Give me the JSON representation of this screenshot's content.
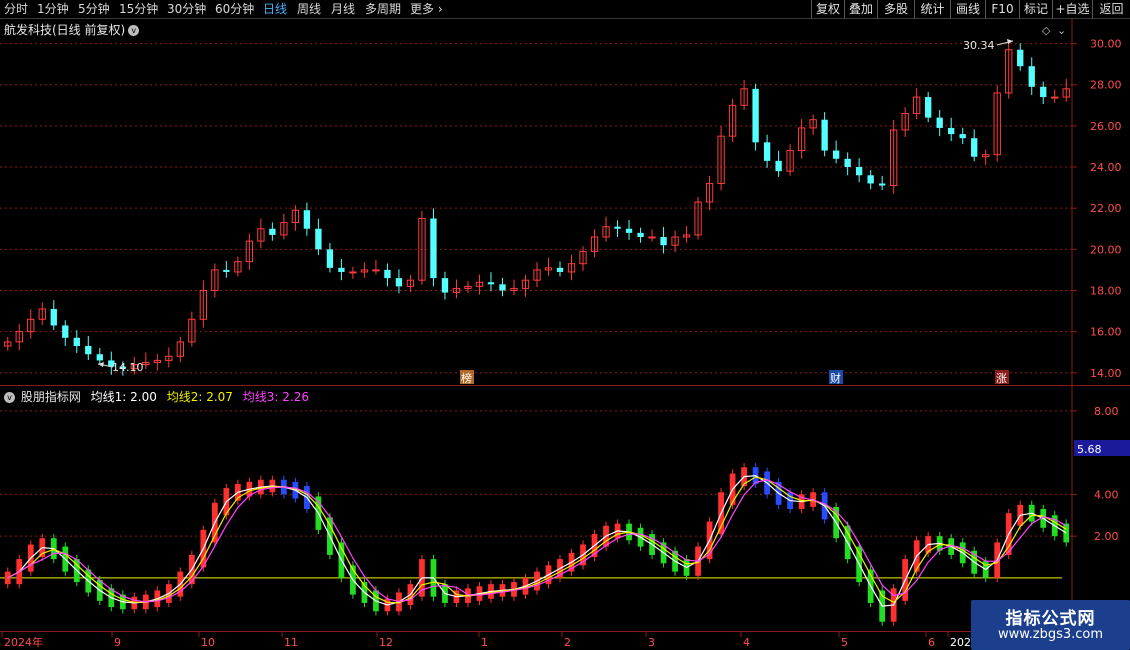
{
  "toolbar": {
    "periods": [
      "分时",
      "1分钟",
      "5分钟",
      "15分钟",
      "30分钟",
      "60分钟",
      "日线",
      "周线",
      "月线",
      "多周期",
      "更多"
    ],
    "active_period": "日线",
    "buttons": [
      "复权",
      "叠加",
      "多股",
      "统计",
      "画线",
      "F10",
      "标记",
      "+自选",
      "返回"
    ]
  },
  "main_panel": {
    "stock_title": "航发科技(日线 前复权)",
    "price_axis_labels": [
      "30.00",
      "28.00",
      "26.00",
      "24.00",
      "22.00",
      "20.00",
      "18.00",
      "16.00",
      "14.00"
    ],
    "high_marker": "30.34",
    "low_marker": "14.10",
    "event_badges": [
      "榜",
      "财",
      "涨"
    ]
  },
  "sub_panel": {
    "indicator_name": "股朋指标网",
    "legend": [
      {
        "label": "均线1: 2.00",
        "color": "#ffffff"
      },
      {
        "label": "均线2: 2.07",
        "color": "#f0f000"
      },
      {
        "label": "均线3: 2.26",
        "color": "#ff44ff"
      }
    ],
    "axis_labels": [
      "8.00",
      "4.00",
      "2.00"
    ],
    "current_value": "5.68"
  },
  "x_axis": {
    "labels": [
      "2024年",
      "9",
      "10",
      "11",
      "12",
      "1",
      "2",
      "3",
      "4",
      "5",
      "6",
      "202"
    ]
  },
  "watermark": {
    "line1": "指标公式网",
    "line2": "www.zbgs3.com"
  },
  "colors": {
    "up": "#ff3c3c",
    "down_main": "#54ffff",
    "grid": "#8b1a1a",
    "axis_text": "#ff4d4d",
    "ma1": "#ffffff",
    "ma2": "#f0f000",
    "ma3": "#ff44ff",
    "baseline": "#f0f000"
  },
  "chart_data": [
    {
      "type": "candlestick",
      "title": "航发科技(日线 前复权)",
      "ylim": [
        13.6,
        31.0
      ],
      "y_ticks": [
        14,
        16,
        18,
        20,
        22,
        24,
        26,
        28,
        30
      ],
      "y_scale_note": "price in CNY, front-adjusted",
      "x_period_labels": [
        "2024年",
        "9",
        "10",
        "11",
        "12",
        "1",
        "2",
        "3",
        "4",
        "5",
        "6",
        "202"
      ],
      "high_annotation": 30.34,
      "low_annotation": 14.1,
      "close_series": [
        15.5,
        16.0,
        16.6,
        17.1,
        16.3,
        15.7,
        15.3,
        14.9,
        14.6,
        14.3,
        14.2,
        14.4,
        14.5,
        14.6,
        14.8,
        15.5,
        16.6,
        18.0,
        19.0,
        18.9,
        19.4,
        20.4,
        21.0,
        20.7,
        21.3,
        21.9,
        21.0,
        20.0,
        19.1,
        18.9,
        18.9,
        19.0,
        19.0,
        18.6,
        18.2,
        18.5,
        21.5,
        18.6,
        17.9,
        18.1,
        18.2,
        18.4,
        18.3,
        18.0,
        18.1,
        18.5,
        19.0,
        19.1,
        18.9,
        19.3,
        19.9,
        20.6,
        21.1,
        21.0,
        20.8,
        20.6,
        20.6,
        20.2,
        20.6,
        20.7,
        22.3,
        23.2,
        25.5,
        27.0,
        27.8,
        25.2,
        24.3,
        23.8,
        24.8,
        25.9,
        26.3,
        24.8,
        24.4,
        24.0,
        23.6,
        23.2,
        23.1,
        25.8,
        26.6,
        27.4,
        26.4,
        25.9,
        25.6,
        25.4,
        24.5,
        24.6,
        27.6,
        29.7,
        28.9,
        27.9,
        27.4,
        27.4,
        27.8
      ]
    },
    {
      "type": "line",
      "title": "股朋指标网",
      "ylim": [
        -2.4,
        9.0
      ],
      "y_ticks": [
        2,
        4,
        8
      ],
      "current_value": 5.68,
      "series": [
        {
          "name": "均线1",
          "last_value": 2.0,
          "color": "#ffffff"
        },
        {
          "name": "均线2",
          "last_value": 2.07,
          "color": "#f0f000"
        },
        {
          "name": "均线3",
          "last_value": 2.26,
          "color": "#ff44ff"
        }
      ],
      "baseline": 0,
      "oscillator": [
        0.0,
        0.6,
        1.3,
        1.6,
        1.2,
        0.6,
        0.1,
        -0.4,
        -0.8,
        -1.1,
        -1.2,
        -1.2,
        -1.1,
        -0.9,
        -0.6,
        0.0,
        0.8,
        2.0,
        3.3,
        4.0,
        4.2,
        4.3,
        4.4,
        4.4,
        4.3,
        4.1,
        3.6,
        2.6,
        1.4,
        0.3,
        -0.5,
        -0.9,
        -1.3,
        -1.3,
        -1.0,
        -0.6,
        0.6,
        -0.6,
        -0.9,
        -0.9,
        -0.8,
        -0.7,
        -0.6,
        -0.6,
        -0.5,
        -0.3,
        0.0,
        0.3,
        0.6,
        0.9,
        1.3,
        1.8,
        2.2,
        2.3,
        2.1,
        1.8,
        1.4,
        1.0,
        0.6,
        0.4,
        1.2,
        2.4,
        3.8,
        4.7,
        5.0,
        4.8,
        4.3,
        3.8,
        3.6,
        3.7,
        3.8,
        3.1,
        2.2,
        1.2,
        0.1,
        -0.9,
        -1.8,
        -0.8,
        0.6,
        1.5,
        1.7,
        1.6,
        1.4,
        1.0,
        0.5,
        0.3,
        1.4,
        2.8,
        3.2,
        3.0,
        2.7,
        2.3,
        2.0
      ]
    }
  ]
}
